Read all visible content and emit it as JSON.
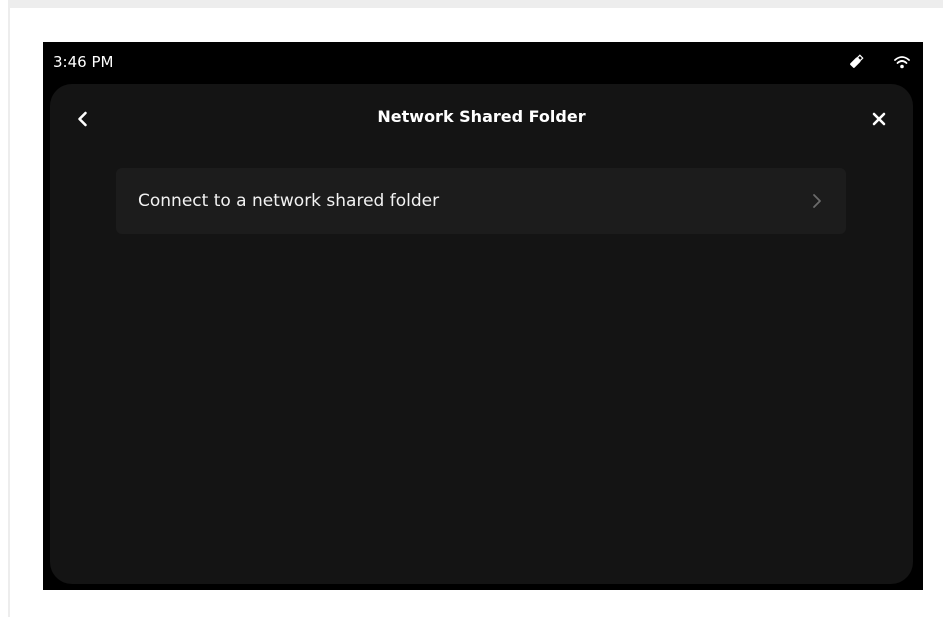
{
  "status_bar": {
    "time": "3:46 PM",
    "icons": [
      "usb-drive-icon",
      "wifi-icon"
    ]
  },
  "panel": {
    "title": "Network Shared Folder",
    "back_icon": "chevron-left-icon",
    "close_icon": "close-icon",
    "items": [
      {
        "label": "Connect to a network shared folder",
        "icon": "chevron-right-icon"
      }
    ]
  },
  "colors": {
    "device_background": "#000000",
    "panel_background": "#141414",
    "item_background": "#1c1c1c",
    "text": "#ffffff",
    "chevron": "#6b6b6b"
  }
}
